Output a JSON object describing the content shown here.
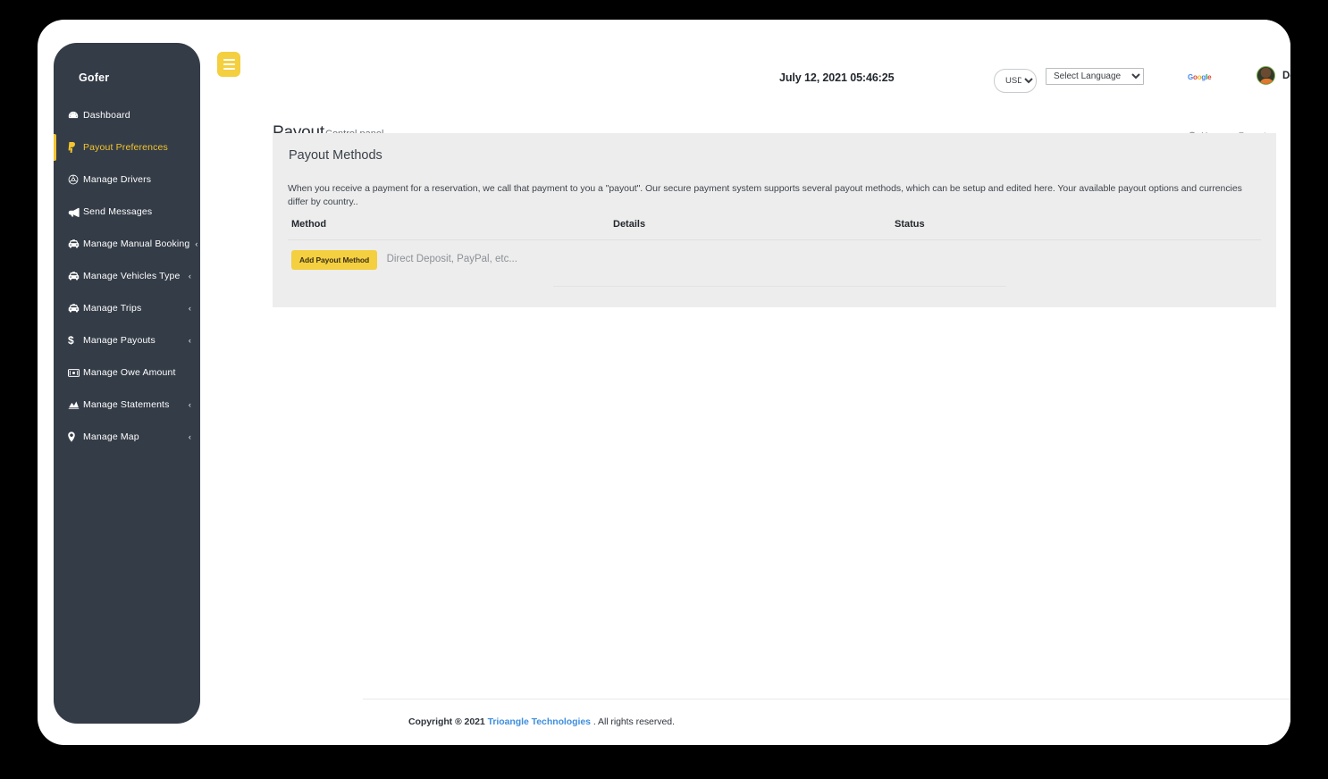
{
  "app": {
    "brand": "Gofer"
  },
  "sidebar": {
    "items": [
      {
        "label": "Dashboard",
        "icon": "dashboard-icon",
        "caret": "",
        "active": false
      },
      {
        "label": "Payout Preferences",
        "icon": "paypal-p-icon",
        "caret": "",
        "active": true
      },
      {
        "label": "Manage Drivers",
        "icon": "steering-wheel-icon",
        "caret": "",
        "active": false
      },
      {
        "label": "Send Messages",
        "icon": "bullhorn-icon",
        "caret": "",
        "active": false
      },
      {
        "label": "Manage Manual Booking",
        "icon": "taxi-icon",
        "caret": "‹",
        "active": false
      },
      {
        "label": "Manage Vehicles Type",
        "icon": "taxi-icon",
        "caret": "‹",
        "active": false
      },
      {
        "label": "Manage Trips",
        "icon": "taxi-icon",
        "caret": "‹",
        "active": false
      },
      {
        "label": "Manage Payouts",
        "icon": "dollar-icon",
        "caret": "‹",
        "active": false
      },
      {
        "label": "Manage Owe Amount",
        "icon": "money-bill-icon",
        "caret": "",
        "active": false
      },
      {
        "label": "Manage Statements",
        "icon": "bar-chart-icon",
        "caret": "‹",
        "active": false
      },
      {
        "label": "Manage Map",
        "icon": "map-pin-icon",
        "caret": "‹",
        "active": false
      }
    ]
  },
  "topbar": {
    "menu_toggle_label": "hamburger-menu",
    "datetime": "July 12, 2021 05:46:25",
    "currency": {
      "selected": "USD",
      "options": [
        "USD"
      ]
    },
    "language": {
      "selected": "Select Language",
      "options": [
        "Select Language"
      ]
    },
    "google_logo": {
      "l1": "G",
      "l2": "o",
      "l3": "o",
      "l4": "g",
      "l5": "l",
      "l6": "e"
    },
    "user": {
      "name": "Devin"
    }
  },
  "page": {
    "title": "Payout",
    "subtitle": "Control panel",
    "breadcrumb": {
      "home": "Home",
      "separator": "»",
      "current": "Payout"
    }
  },
  "panel": {
    "title": "Payout Methods",
    "description": "When you receive a payment for a reservation, we call that payment to you a \"payout\". Our secure payment system supports several payout methods, which can be setup and edited here. Your available payout options and currencies differ by country..",
    "table": {
      "headers": [
        "Method",
        "Details",
        "Status"
      ],
      "rows": [
        {
          "method_button": "Add Payout Method",
          "details": "Direct Deposit, PayPal, etc...",
          "status": ""
        }
      ]
    }
  },
  "footer": {
    "copyright_prefix": "Copyright ® 2021 ",
    "company": "Trioangle Technologies",
    "copyright_suffix": " . All rights reserved."
  },
  "colors": {
    "accent": "#f4cf40",
    "sidebar_bg": "#343c47",
    "panel_bg": "#ededed",
    "link": "#3e8ede"
  }
}
